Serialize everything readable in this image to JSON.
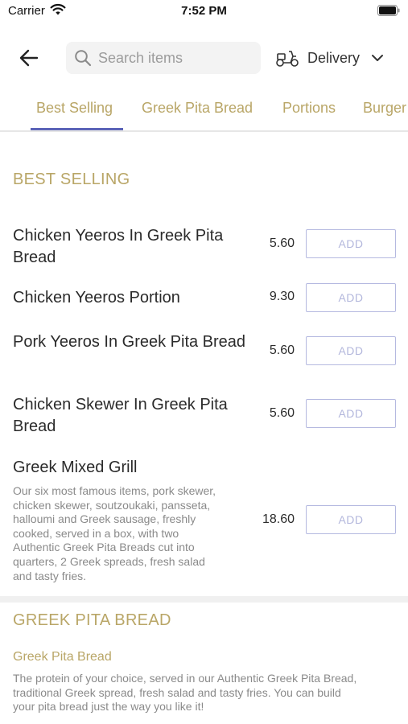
{
  "status_bar": {
    "carrier": "Carrier",
    "time": "7:52 PM"
  },
  "header": {
    "search_placeholder": "Search items",
    "delivery_label": "Delivery"
  },
  "tabs": [
    "Best Selling",
    "Greek Pita Bread",
    "Portions",
    "Burger"
  ],
  "active_tab": "Best Selling",
  "colors": {
    "accent": "#b9a667",
    "tab_indicator": "#5b64b8",
    "add_border": "#b5b9e0"
  },
  "sections": [
    {
      "title": "BEST SELLING",
      "items": [
        {
          "name": "Chicken Yeeros In Greek Pita Bread",
          "price": "5.60",
          "action": "ADD"
        },
        {
          "name": "Chicken Yeeros Portion",
          "price": "9.30",
          "action": "ADD"
        },
        {
          "name": "Pork Yeeros In Greek Pita Bread",
          "price": "5.60",
          "action": "ADD"
        },
        {
          "name": "Chicken Skewer In Greek Pita Bread",
          "price": "5.60",
          "action": "ADD"
        },
        {
          "name": "Greek Mixed Grill",
          "price": "18.60",
          "action": "ADD",
          "description": [
            "Our six most famous items, pork skewer,",
            "chicken skewer, soutzoukaki, pansseta,",
            "halloumi and Greek sausage, freshly",
            "cooked, served in a box, with two",
            "Authentic Greek Pita Breads cut into",
            "quarters, 2 Greek spreads, fresh salad",
            "and tasty fries."
          ]
        }
      ]
    },
    {
      "title": "GREEK PITA BREAD",
      "subtitle": "Greek Pita Bread",
      "description": [
        "The protein of your choice, served in our Authentic Greek Pita Bread,",
        "traditional Greek spread, fresh salad and tasty fries. You can build",
        "your pita bread just the way you like it!"
      ]
    }
  ]
}
